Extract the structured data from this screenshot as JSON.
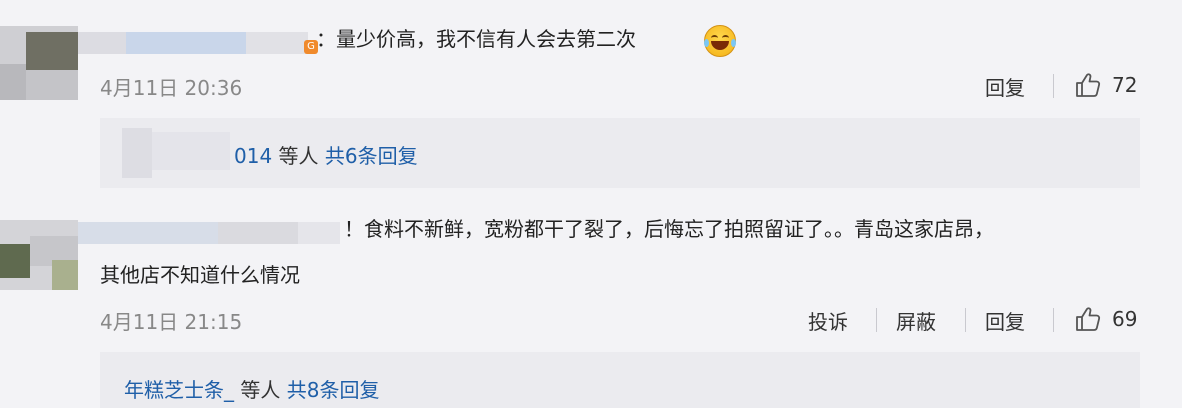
{
  "comments": [
    {
      "text": "：量少价高，我不信有人会去第二次",
      "timestamp": "4月11日 20:36",
      "actions": {
        "reply": "回复"
      },
      "likes": "72",
      "replies": {
        "name_suffix": "014",
        "mid": " 等人 ",
        "count_text": "共6条回复"
      }
    },
    {
      "text_line1": "！食料不新鲜，宽粉都干了裂了，后悔忘了拍照留证了。。青岛这家店昂，",
      "text_line2": "其他店不知道什么情况",
      "timestamp": "4月11日 21:15",
      "actions": {
        "report": "投诉",
        "block": "屏蔽",
        "reply": "回复"
      },
      "likes": "69",
      "replies": {
        "name": "年糕芝士条_",
        "mid": " 等人 ",
        "count_text": "共8条回复"
      }
    }
  ],
  "icons": {
    "badge": "G",
    "emoji": "laughing-tears-emoji",
    "like": "thumbs-up-icon"
  },
  "colors": {
    "link": "#1f5fa8",
    "background": "#f3f3f6",
    "reply_box": "#ebebef"
  }
}
